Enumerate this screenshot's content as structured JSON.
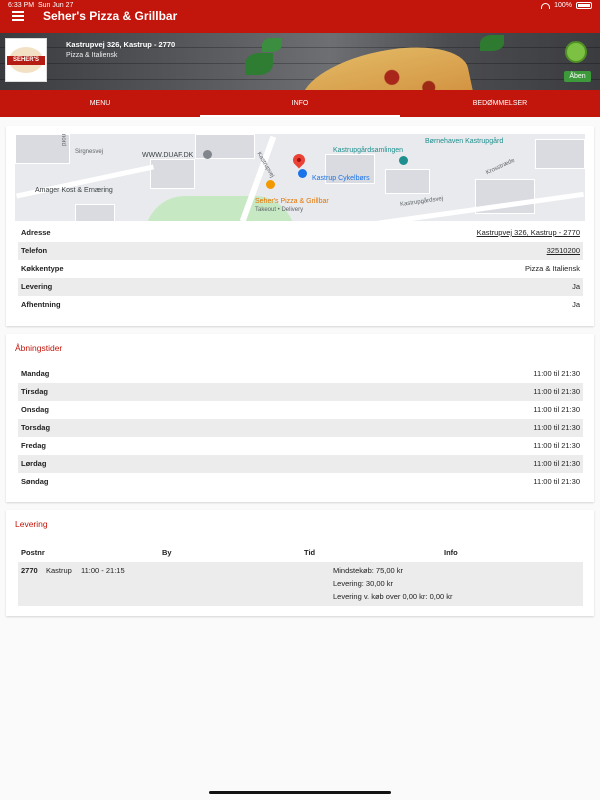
{
  "status_bar": {
    "time": "6:33 PM",
    "date": "Sun Jun 27",
    "battery": "100%"
  },
  "app_bar": {
    "title": "Seher's Pizza & Grillbar",
    "menu_icon": "hamburger-menu-icon"
  },
  "hero": {
    "logo_text": "SEHER'S",
    "address": "Kastrupvej 326, Kastrup - 2770",
    "cuisine": "Pizza & Italiensk",
    "open_status": "Åben",
    "smiley_icon": "smiley-inspection-icon"
  },
  "tabs": [
    {
      "label": "MENU",
      "active": false
    },
    {
      "label": "INFO",
      "active": true
    },
    {
      "label": "BEDØMMELSER",
      "active": false
    }
  ],
  "map": {
    "labels": {
      "kastrupgaardsamlingen": "Kastrupgårdsamlingen",
      "boernehaven": "Børnehaven Kastrupgård",
      "duaf": "WWW.DUAF.DK",
      "amager": "Amager Kost & Ernæring",
      "cykelboers": "Kastrup Cykelbørs",
      "restaurant": "Seher's Pizza & Grillbar",
      "restaurant_sub": "Takeout • Delivery",
      "road_kastrupvej": "Kastrupvej",
      "road_kastrupgaardsvej": "Kastrupgårdsvej",
      "road_krosstraede": "Krosstræde",
      "road_sirgnesvej": "Sirgnesvej",
      "road_nord": "nord"
    }
  },
  "info": {
    "rows": [
      {
        "key": "Adresse",
        "value": "Kastrupvej 326, Kastrup - 2770",
        "link": true
      },
      {
        "key": "Telefon",
        "value": "32510200",
        "link": true
      },
      {
        "key": "Køkkentype",
        "value": "Pizza & Italiensk",
        "link": false
      },
      {
        "key": "Levering",
        "value": "Ja",
        "link": false
      },
      {
        "key": "Afhentning",
        "value": "Ja",
        "link": false
      }
    ]
  },
  "hours": {
    "title": "Åbningstider",
    "days": [
      {
        "day": "Mandag",
        "time": "11:00 til 21:30"
      },
      {
        "day": "Tirsdag",
        "time": "11:00 til 21:30"
      },
      {
        "day": "Onsdag",
        "time": "11:00 til 21:30"
      },
      {
        "day": "Torsdag",
        "time": "11:00 til 21:30"
      },
      {
        "day": "Fredag",
        "time": "11:00 til 21:30"
      },
      {
        "day": "Lørdag",
        "time": "11:00 til 21:30"
      },
      {
        "day": "Søndag",
        "time": "11:00 til 21:30"
      }
    ]
  },
  "delivery": {
    "title": "Levering",
    "headers": {
      "postnr": "Postnr",
      "by": "By",
      "tid": "Tid",
      "info": "Info"
    },
    "row": {
      "postnr": "2770",
      "city": "Kastrup",
      "time": "11:00 - 21:15",
      "min_order": "Mindstekøb: 75,00 kr",
      "fee": "Levering: 30,00 kr",
      "fee_over": "Levering v. køb over 0,00 kr: 0,00 kr"
    }
  },
  "colors": {
    "brand": "#c2150b",
    "open": "#3d9a3a",
    "row_alt": "#ececec"
  }
}
